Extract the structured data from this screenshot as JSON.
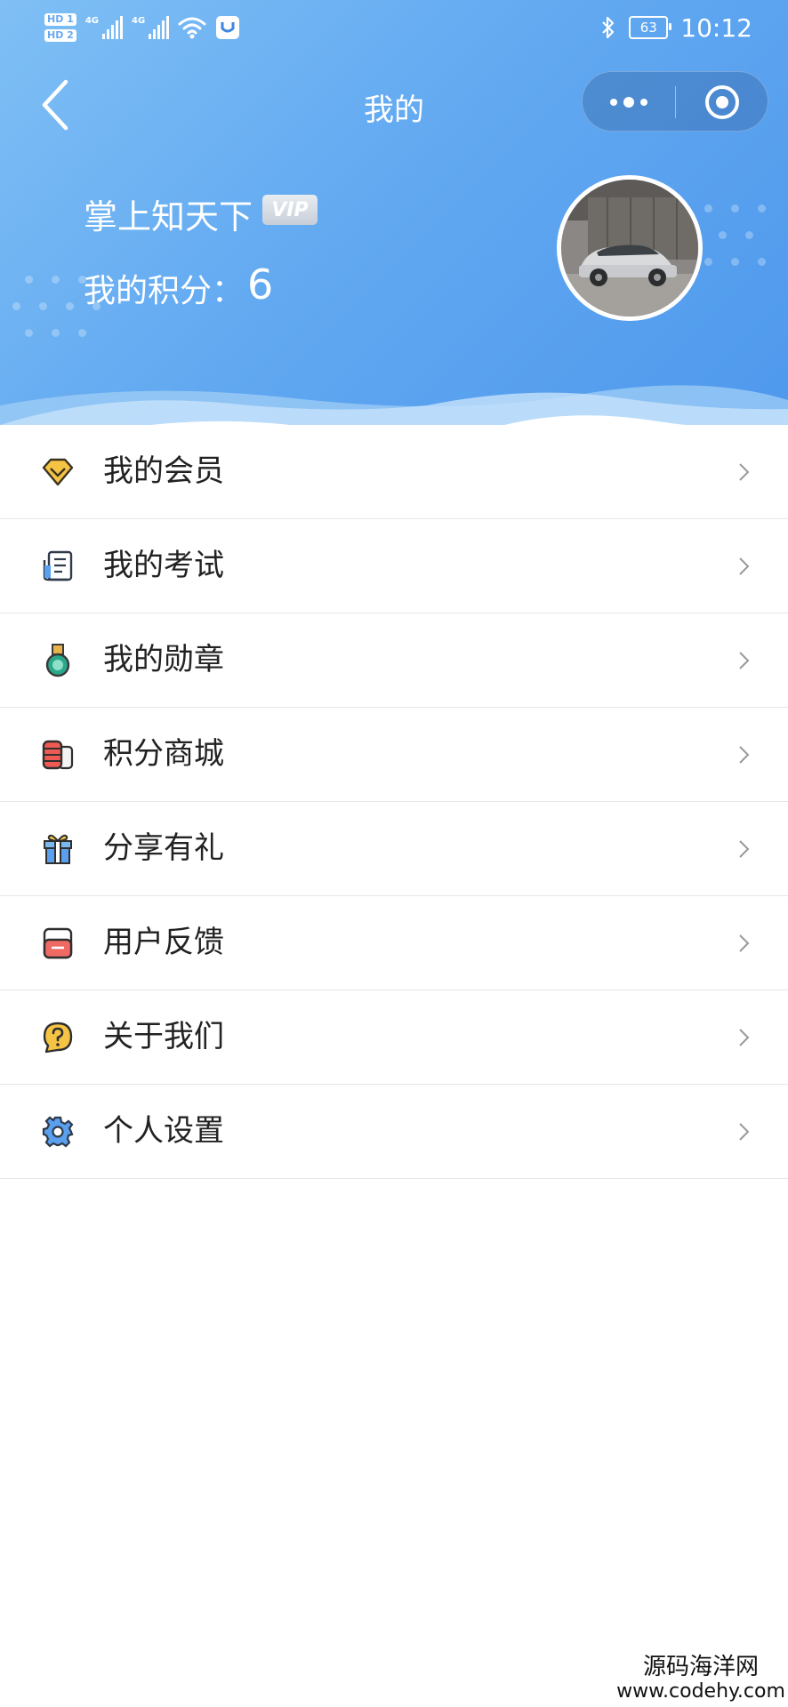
{
  "status_bar": {
    "hd_badges": [
      "HD 1",
      "HD 2"
    ],
    "network_labels": [
      "4G",
      "4G"
    ],
    "battery_level": "63",
    "time": "10:12"
  },
  "nav": {
    "title": "我的"
  },
  "profile": {
    "name": "掌上知天下",
    "vip_label": "VIP",
    "points_label": "我的积分：",
    "points_value": "6"
  },
  "menu": {
    "items": [
      {
        "label": "我的会员",
        "icon": "diamond-icon"
      },
      {
        "label": "我的考试",
        "icon": "exam-paper-icon"
      },
      {
        "label": "我的勋章",
        "icon": "medal-icon"
      },
      {
        "label": "积分商城",
        "icon": "coins-stack-icon"
      },
      {
        "label": "分享有礼",
        "icon": "gift-icon"
      },
      {
        "label": "用户反馈",
        "icon": "feedback-icon"
      },
      {
        "label": "关于我们",
        "icon": "question-bubble-icon"
      },
      {
        "label": "个人设置",
        "icon": "gear-icon"
      }
    ]
  },
  "watermark": {
    "line1": "源码海洋网",
    "line2": "www.codehy.com"
  }
}
